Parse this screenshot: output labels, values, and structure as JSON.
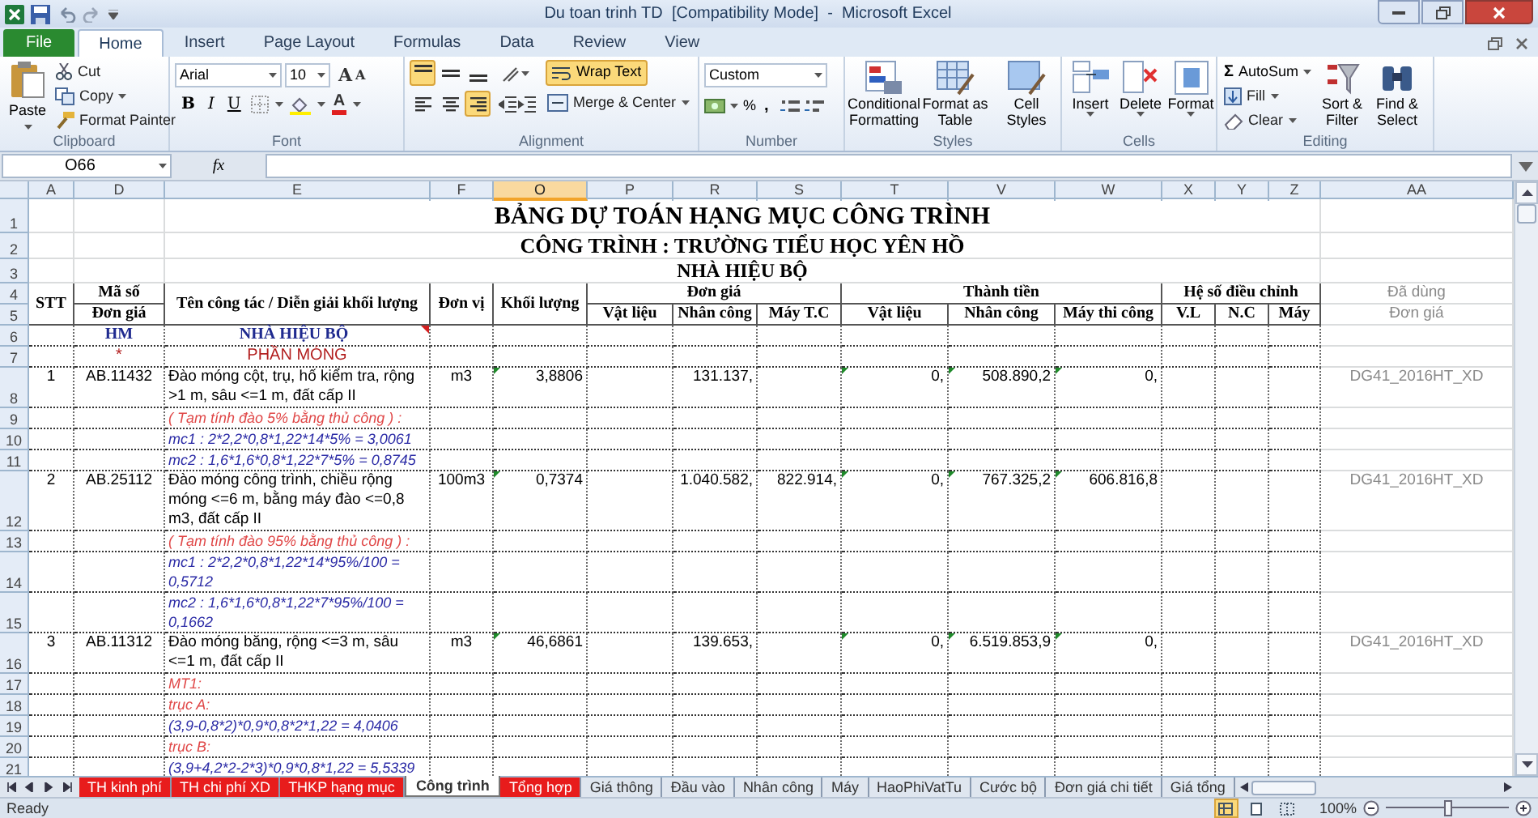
{
  "window": {
    "title": "Du toan trinh TD  [Compatibility Mode]  -  Microsoft Excel"
  },
  "ribbon_tabs": [
    {
      "label": "File",
      "kind": "file",
      "selected": false
    },
    {
      "label": "Home",
      "kind": "tab",
      "selected": true
    },
    {
      "label": "Insert",
      "kind": "tab",
      "selected": false
    },
    {
      "label": "Page Layout",
      "kind": "tab",
      "selected": false
    },
    {
      "label": "Formulas",
      "kind": "tab",
      "selected": false
    },
    {
      "label": "Data",
      "kind": "tab",
      "selected": false
    },
    {
      "label": "Review",
      "kind": "tab",
      "selected": false
    },
    {
      "label": "View",
      "kind": "tab",
      "selected": false
    }
  ],
  "clipboard": {
    "label": "Clipboard",
    "paste": "Paste",
    "cut": "Cut",
    "copy": "Copy",
    "format_painter": "Format Painter"
  },
  "font": {
    "label": "Font",
    "name": "Arial",
    "size": "10",
    "grow": "A",
    "shrink": "A",
    "style_buttons": [
      "B",
      "I",
      "U"
    ],
    "font_color": "A"
  },
  "alignment": {
    "label": "Alignment",
    "vertical": [
      {
        "kind": "top",
        "selected": true
      },
      {
        "kind": "middle",
        "selected": false
      },
      {
        "kind": "bottom",
        "selected": false
      }
    ],
    "horizontal": [
      {
        "kind": "left",
        "selected": false
      },
      {
        "kind": "center",
        "selected": false
      },
      {
        "kind": "right",
        "selected": true
      }
    ],
    "wrap_text": {
      "label": "Wrap Text",
      "selected": true
    },
    "merge": "Merge & Center"
  },
  "number": {
    "label": "Number",
    "format": "Custom",
    "percent": "%",
    "comma": ","
  },
  "styles": {
    "label": "Styles",
    "buttons": [
      "Conditional Formatting",
      "Format as Table",
      "Cell Styles"
    ]
  },
  "cells_group": {
    "label": "Cells",
    "buttons": [
      "Insert",
      "Delete",
      "Format"
    ]
  },
  "editing": {
    "label": "Editing",
    "autosum_symbol": "Σ",
    "autosum": "AutoSum",
    "fill": "Fill",
    "clear": "Clear",
    "sort": "Sort & Filter",
    "find": "Find & Select"
  },
  "formula_bar": {
    "name_box": "O66",
    "fx": "fx"
  },
  "columns": [
    {
      "label": "A",
      "selected": false
    },
    {
      "label": "D",
      "selected": false
    },
    {
      "label": "E",
      "selected": false
    },
    {
      "label": "F",
      "selected": false
    },
    {
      "label": "O",
      "selected": true
    },
    {
      "label": "P",
      "selected": false
    },
    {
      "label": "R",
      "selected": false
    },
    {
      "label": "S",
      "selected": false
    },
    {
      "label": "T",
      "selected": false
    },
    {
      "label": "V",
      "selected": false
    },
    {
      "label": "W",
      "selected": false
    },
    {
      "label": "X",
      "selected": false
    },
    {
      "label": "Y",
      "selected": false
    },
    {
      "label": "Z",
      "selected": false
    },
    {
      "label": "AA",
      "selected": false
    }
  ],
  "rows": [
    {
      "number": "1",
      "kind": "title",
      "cells": {
        "E": {
          "text": "BẢNG DỰ TOÁN HẠNG MỤC CÔNG TRÌNH",
          "kind": "title",
          "merged_right": true
        }
      }
    },
    {
      "number": "2",
      "kind": "title",
      "cells": {
        "E": {
          "text": "CÔNG TRÌNH : TRƯỜNG TIỂU HỌC YÊN HỒ",
          "kind": "subtitle",
          "merged_right": true
        }
      }
    },
    {
      "number": "3",
      "kind": "title",
      "cells": {
        "E": {
          "text": "NHÀ HIỆU BỘ",
          "kind": "subtitle2",
          "merged_right": true
        }
      }
    },
    {
      "number": "4",
      "kind": "header",
      "cells": {
        "A": {
          "text": "STT",
          "kind": "header",
          "merged_down": true
        },
        "D": {
          "text": "Mã số",
          "kind": "header"
        },
        "E": {
          "text": "Tên công tác / Diễn giải khối lượng",
          "kind": "header",
          "merged_down": true
        },
        "F": {
          "text": "Đơn vị",
          "kind": "header",
          "merged_down": true
        },
        "O": {
          "text": "Khối lượng",
          "kind": "header",
          "merged_down": true
        },
        "P": {
          "text": "Đơn giá",
          "kind": "header",
          "merged_right": true
        },
        "T": {
          "text": "Thành tiền",
          "kind": "header",
          "merged_right": true
        },
        "X": {
          "text": "Hệ số điều chỉnh",
          "kind": "header",
          "merged_right": true
        },
        "AA": {
          "text": "Đã dùng",
          "kind": "ref-right"
        }
      }
    },
    {
      "number": "5",
      "kind": "header",
      "cells": {
        "D": {
          "text": "Đơn giá",
          "kind": "header"
        },
        "P": {
          "text": "Vật liệu",
          "kind": "header"
        },
        "R": {
          "text": "Nhân công",
          "kind": "header"
        },
        "S": {
          "text": "Máy T.C",
          "kind": "header"
        },
        "T": {
          "text": "Vật liệu",
          "kind": "header"
        },
        "V": {
          "text": "Nhân công",
          "kind": "header"
        },
        "W": {
          "text": "Máy thi công",
          "kind": "header"
        },
        "X": {
          "text": "V.L",
          "kind": "header"
        },
        "Y": {
          "text": "N.C",
          "kind": "header"
        },
        "Z": {
          "text": "Máy",
          "kind": "header"
        },
        "AA": {
          "text": "Đơn giá",
          "kind": "ref"
        }
      }
    },
    {
      "number": "6",
      "kind": "item",
      "cells": {
        "D": {
          "text": "HM",
          "kind": "code"
        },
        "E": {
          "text": "NHÀ HIỆU BỘ",
          "kind": "code",
          "comment": true
        }
      }
    },
    {
      "number": "7",
      "kind": "item",
      "cells": {
        "D": {
          "text": "*",
          "kind": "section"
        },
        "E": {
          "text": "PHẦN MÓNG",
          "kind": "section"
        }
      }
    },
    {
      "number": "8",
      "kind": "item",
      "cells": {
        "A": {
          "text": "1",
          "kind": "center"
        },
        "D": {
          "text": "AB.11432",
          "kind": "center"
        },
        "E": {
          "text": "Đào móng cột, trụ, hố kiểm tra, rộng >1 m, sâu <=1 m, đất cấp II",
          "kind": "text"
        },
        "F": {
          "text": "m3",
          "kind": "center"
        },
        "O": {
          "text": "3,8806",
          "kind": "number",
          "flag": true
        },
        "R": {
          "text": "131.137,",
          "kind": "number"
        },
        "T": {
          "text": "0,",
          "kind": "number",
          "flag": true
        },
        "V": {
          "text": "508.890,2",
          "kind": "number",
          "flag": true
        },
        "W": {
          "text": "0,",
          "kind": "number",
          "flag": true
        },
        "AA": {
          "text": "DG41_2016HT_XD",
          "kind": "ref"
        }
      }
    },
    {
      "number": "9",
      "kind": "item",
      "cells": {
        "E": {
          "text": "( Tạm tính đào 5% bằng thủ công ) :",
          "kind": "note"
        }
      }
    },
    {
      "number": "10",
      "kind": "item",
      "cells": {
        "E": {
          "text": "mc1 : 2*2,2*0,8*1,22*14*5% = 3,0061",
          "kind": "formula"
        }
      }
    },
    {
      "number": "11",
      "kind": "item",
      "cells": {
        "E": {
          "text": "mc2 : 1,6*1,6*0,8*1,22*7*5% = 0,8745",
          "kind": "formula"
        }
      }
    },
    {
      "number": "12",
      "kind": "item",
      "cells": {
        "A": {
          "text": "2",
          "kind": "center"
        },
        "D": {
          "text": "AB.25112",
          "kind": "center"
        },
        "E": {
          "text": "Đào móng công trình, chiều rộng móng <=6 m, bằng máy đào <=0,8 m3, đất cấp II",
          "kind": "text"
        },
        "F": {
          "text": "100m3",
          "kind": "center"
        },
        "O": {
          "text": "0,7374",
          "kind": "number",
          "flag": true
        },
        "R": {
          "text": "1.040.582,",
          "kind": "number"
        },
        "S": {
          "text": "822.914,",
          "kind": "number"
        },
        "T": {
          "text": "0,",
          "kind": "number",
          "flag": true
        },
        "V": {
          "text": "767.325,2",
          "kind": "number",
          "flag": true
        },
        "W": {
          "text": "606.816,8",
          "kind": "number",
          "flag": true
        },
        "AA": {
          "text": "DG41_2016HT_XD",
          "kind": "ref"
        }
      }
    },
    {
      "number": "13",
      "kind": "item",
      "cells": {
        "E": {
          "text": "( Tạm tính đào 95% bằng thủ công ) :",
          "kind": "note"
        }
      }
    },
    {
      "number": "14",
      "kind": "item",
      "cells": {
        "E": {
          "text": "mc1 : 2*2,2*0,8*1,22*14*95%/100 = 0,5712",
          "kind": "formula"
        }
      }
    },
    {
      "number": "15",
      "kind": "item",
      "cells": {
        "E": {
          "text": "mc2 : 1,6*1,6*0,8*1,22*7*95%/100 = 0,1662",
          "kind": "formula"
        }
      }
    },
    {
      "number": "16",
      "kind": "item",
      "cells": {
        "A": {
          "text": "3",
          "kind": "center"
        },
        "D": {
          "text": "AB.11312",
          "kind": "center"
        },
        "E": {
          "text": "Đào móng băng, rộng <=3 m, sâu <=1 m, đất cấp II",
          "kind": "text"
        },
        "F": {
          "text": "m3",
          "kind": "center"
        },
        "O": {
          "text": "46,6861",
          "kind": "number",
          "flag": true
        },
        "R": {
          "text": "139.653,",
          "kind": "number"
        },
        "T": {
          "text": "0,",
          "kind": "number",
          "flag": true
        },
        "V": {
          "text": "6.519.853,9",
          "kind": "number",
          "flag": true
        },
        "W": {
          "text": "0,",
          "kind": "number",
          "flag": true
        },
        "AA": {
          "text": "DG41_2016HT_XD",
          "kind": "ref"
        }
      }
    },
    {
      "number": "17",
      "kind": "item",
      "cells": {
        "E": {
          "text": "MT1:",
          "kind": "note"
        }
      }
    },
    {
      "number": "18",
      "kind": "item",
      "cells": {
        "E": {
          "text": "trục A:",
          "kind": "note"
        }
      }
    },
    {
      "number": "19",
      "kind": "item",
      "cells": {
        "E": {
          "text": "(3,9-0,8*2)*0,9*0,8*2*1,22 = 4,0406",
          "kind": "formula"
        }
      }
    },
    {
      "number": "20",
      "kind": "item",
      "cells": {
        "E": {
          "text": "trục B:",
          "kind": "note"
        }
      }
    },
    {
      "number": "21",
      "kind": "item",
      "cells": {
        "E": {
          "text": "(3,9+4,2*2-2*3)*0,9*0,8*1,22 = 5,5339",
          "kind": "formula"
        }
      }
    }
  ],
  "sheet_tabs": [
    {
      "label": "TH kinh phí",
      "color": "#e81c1c",
      "selected": false
    },
    {
      "label": "TH chi phí XD",
      "color": "#e81c1c",
      "selected": false
    },
    {
      "label": "THKP hạng mục",
      "color": "#e81c1c",
      "selected": false
    },
    {
      "label": "Công trình",
      "selected": true
    },
    {
      "label": "Tổng hợp",
      "color": "#e81c1c",
      "selected": false
    },
    {
      "label": "Giá thông",
      "selected": false
    },
    {
      "label": "Đầu vào",
      "selected": false
    },
    {
      "label": "Nhân công",
      "selected": false
    },
    {
      "label": "Máy",
      "selected": false
    },
    {
      "label": "HaoPhiVatTu",
      "selected": false
    },
    {
      "label": "Cước bộ",
      "selected": false
    },
    {
      "label": "Đơn giá chi tiết",
      "selected": false
    },
    {
      "label": "Giá tổng",
      "selected": false
    }
  ],
  "status_bar": {
    "text": "Ready",
    "views": [
      {
        "kind": "normal",
        "selected": true
      },
      {
        "kind": "layout",
        "selected": false
      },
      {
        "kind": "break",
        "selected": false
      }
    ],
    "zoom": "100%",
    "zoom_slider": {
      "level": 0.5
    }
  }
}
